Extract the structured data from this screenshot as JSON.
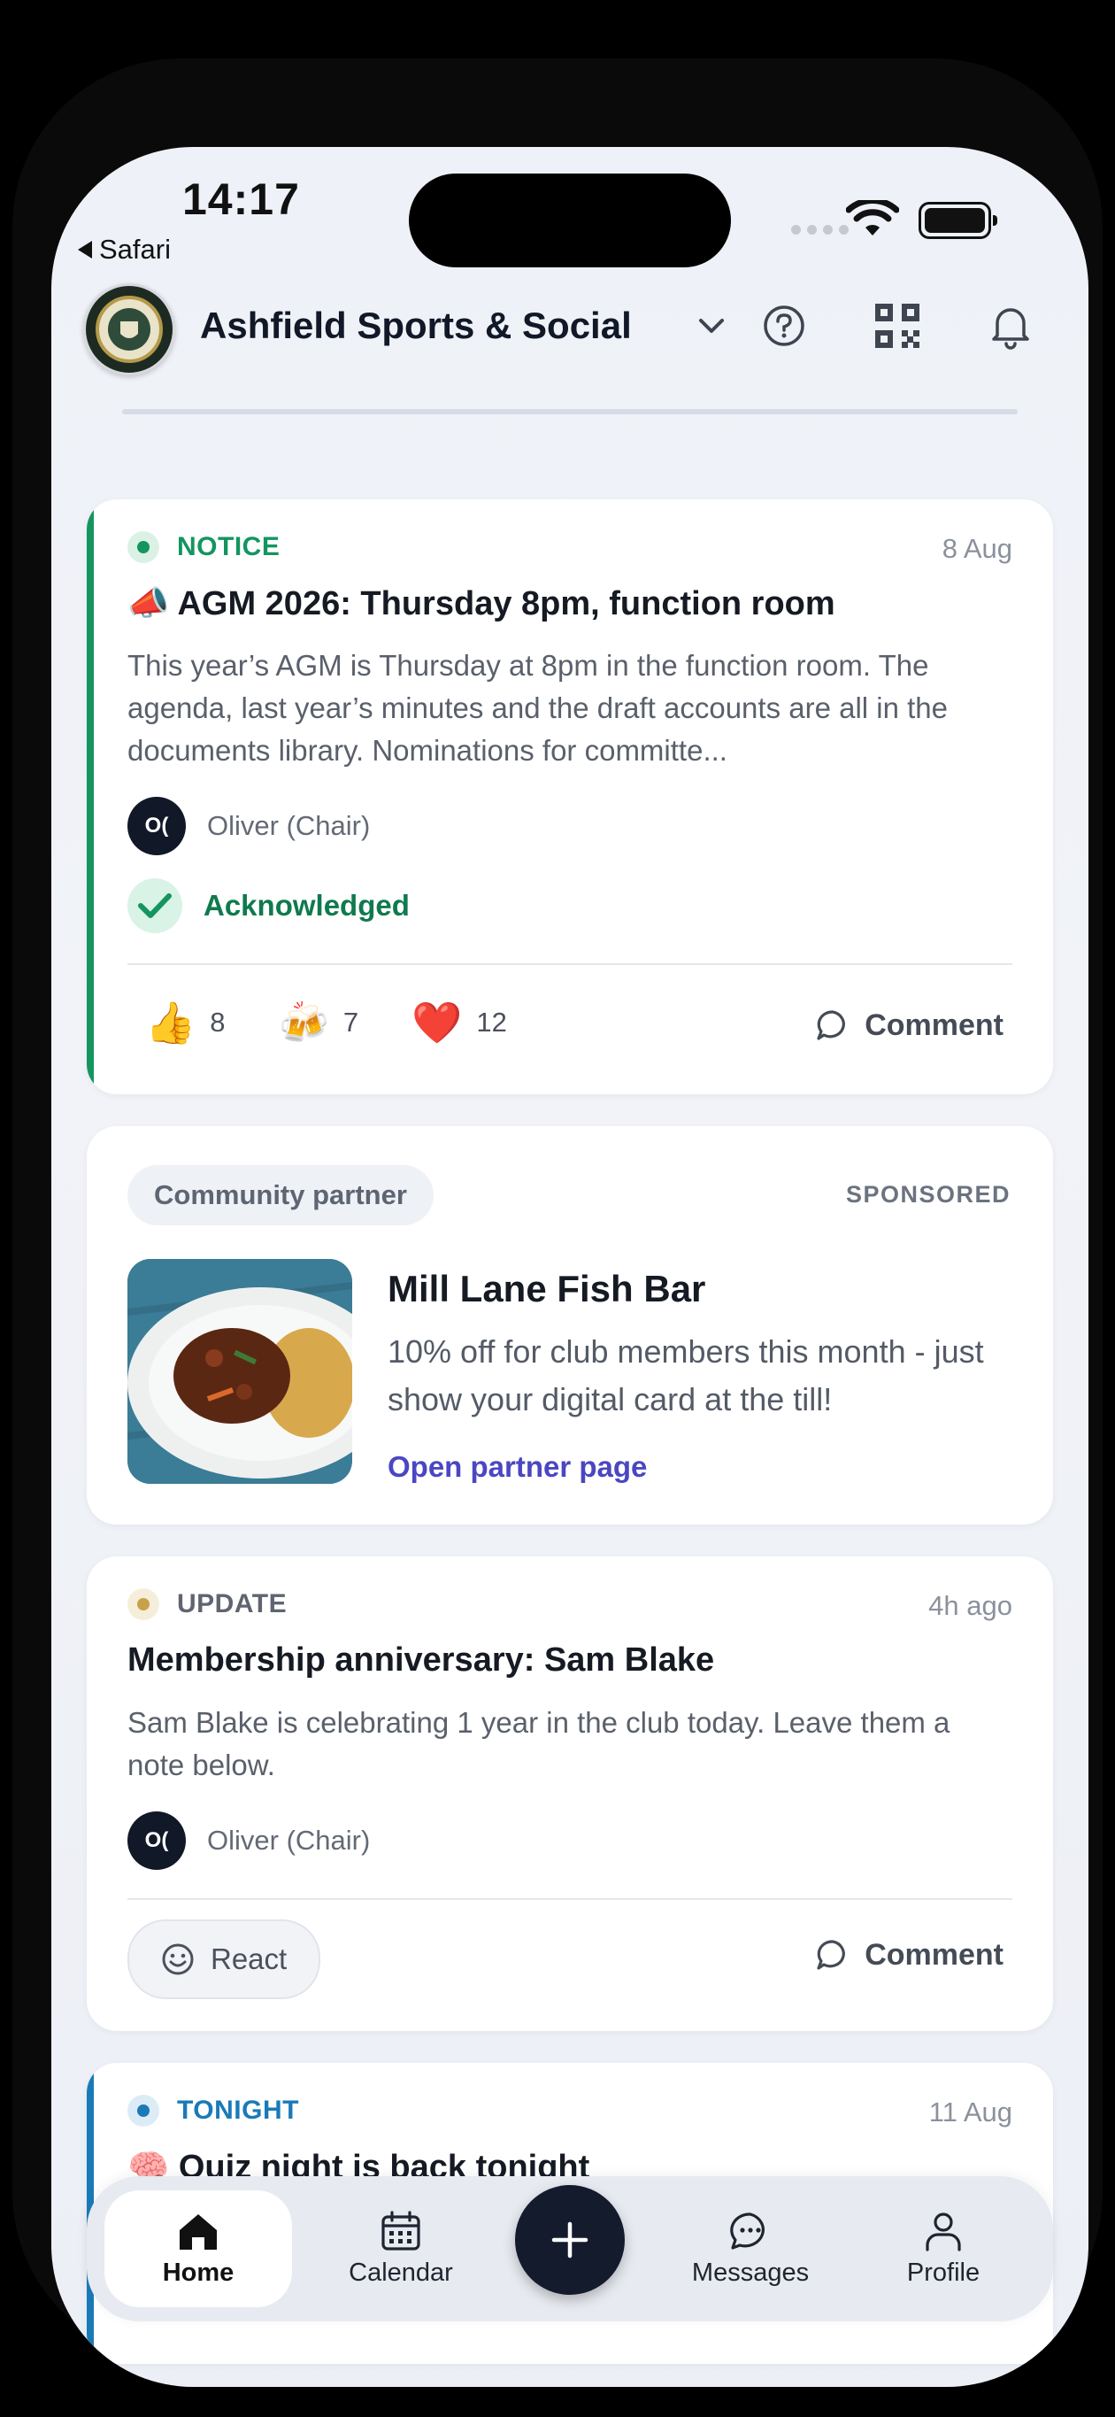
{
  "status_bar": {
    "time": "14:17",
    "back_app": "Safari"
  },
  "header": {
    "club_name": "Ashfield Sports & Social"
  },
  "posts": [
    {
      "tag": "NOTICE",
      "tag_color": "#14955f",
      "date": "8 Aug",
      "title": "📣 AGM 2026: Thursday 8pm, function room",
      "body": "This year’s AGM is Thursday at 8pm in the function room. The agenda, last year’s minutes and the draft accounts are all in the documents library. Nominations for committe...",
      "author_initials": "O(",
      "author": "Oliver (Chair)",
      "acknowledged": "Acknowledged",
      "reactions": [
        {
          "emoji": "👍",
          "count": "8"
        },
        {
          "emoji": "🍻",
          "count": "7"
        },
        {
          "emoji": "❤️",
          "count": "12"
        }
      ],
      "comment_label": "Comment"
    },
    {
      "tag": "UPDATE",
      "tag_color": "#c8a24a",
      "date": "4h ago",
      "title": "Membership anniversary: Sam Blake",
      "body": "Sam Blake is celebrating 1 year in the club today. Leave them a note below.",
      "author_initials": "O(",
      "author": "Oliver (Chair)",
      "react_label": "React",
      "comment_label": "Comment"
    },
    {
      "tag": "TONIGHT",
      "tag_color": "#1a7ab8",
      "date": "11 Aug",
      "title": "🧠 Quiz night is back tonight"
    }
  ],
  "sponsored": {
    "chip": "Community partner",
    "label": "SPONSORED",
    "name": "Mill Lane Fish Bar",
    "description": "10% off for club members this month - just show your digital card at the till!",
    "link": "Open partner page"
  },
  "nav": {
    "items": [
      {
        "label": "Home",
        "icon": "home-icon"
      },
      {
        "label": "Calendar",
        "icon": "calendar-icon"
      },
      {
        "label": "Messages",
        "icon": "chat-icon"
      },
      {
        "label": "Profile",
        "icon": "person-icon"
      }
    ],
    "fab_icon": "plus-icon"
  }
}
